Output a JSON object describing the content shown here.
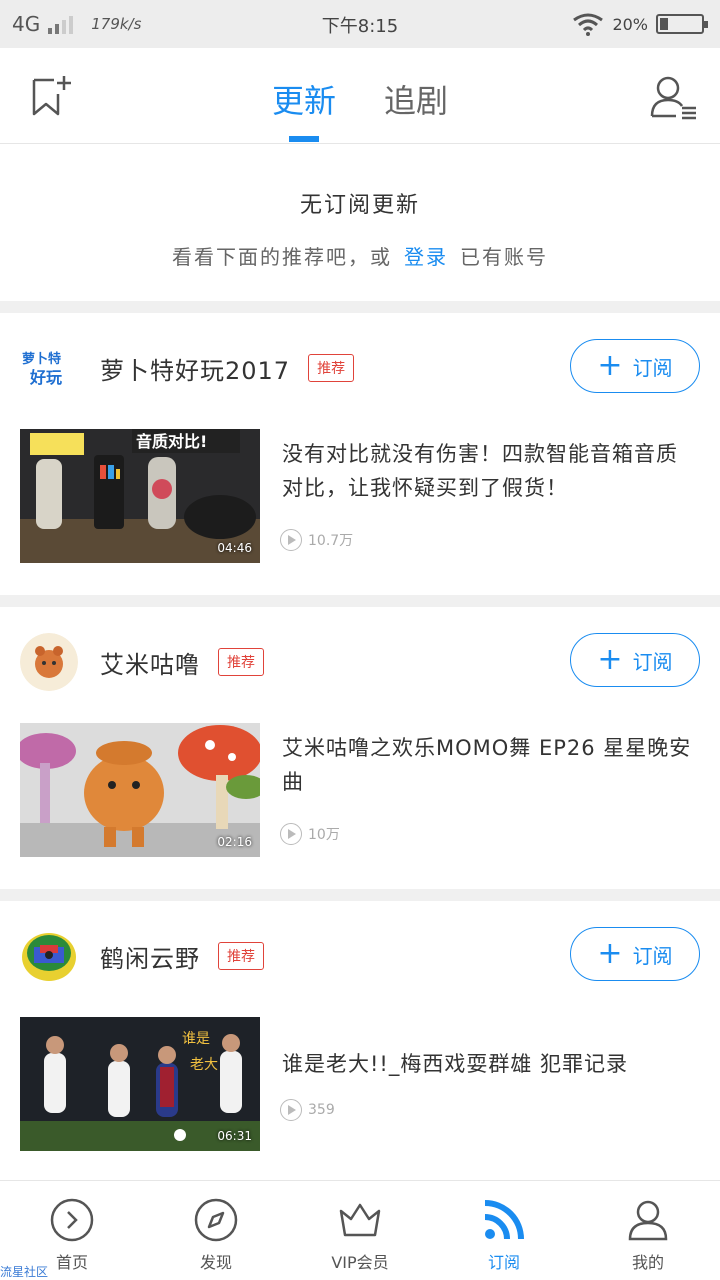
{
  "status_bar": {
    "network": "4G",
    "speed": "179k/s",
    "time": "下午8:15",
    "battery_text": "20%",
    "battery_level": 0.2
  },
  "header": {
    "tabs": [
      {
        "label": "更新",
        "active": true
      },
      {
        "label": "追剧",
        "active": false
      }
    ],
    "left_icon": "bookmark-add-icon",
    "right_icon": "user-list-icon"
  },
  "notice": {
    "title": "无订阅更新",
    "sub_before": "看看下面的推荐吧，或",
    "login_link": "登录",
    "sub_after": "已有账号"
  },
  "channels": [
    {
      "name": "萝卜特好玩2017",
      "badge": "推荐",
      "subscribe_label": "订阅",
      "video_title": "没有对比就没有伤害！四款智能音箱音质对比，让我怀疑买到了假货！",
      "duration": "04:46",
      "views": "10.7万"
    },
    {
      "name": "艾米咕噜",
      "badge": "推荐",
      "subscribe_label": "订阅",
      "video_title": "艾米咕噜之欢乐MOMO舞 EP26 星星晚安曲",
      "duration": "02:16",
      "views": "10万"
    },
    {
      "name": "鹤闲云野",
      "badge": "推荐",
      "subscribe_label": "订阅",
      "video_title": "谁是老大!!_梅西戏耍群雄 犯罪记录",
      "duration": "06:31",
      "views": "359"
    }
  ],
  "bottom_nav": [
    {
      "label": "首页",
      "icon": "play-circle-icon",
      "active": false
    },
    {
      "label": "发现",
      "icon": "compass-icon",
      "active": false
    },
    {
      "label": "VIP会员",
      "icon": "crown-icon",
      "active": false
    },
    {
      "label": "订阅",
      "icon": "rss-icon",
      "active": true
    },
    {
      "label": "我的",
      "icon": "user-icon",
      "active": false
    }
  ],
  "watermark": "流星社区",
  "colors": {
    "accent": "#1a8cf0",
    "badge": "#e0433a"
  }
}
